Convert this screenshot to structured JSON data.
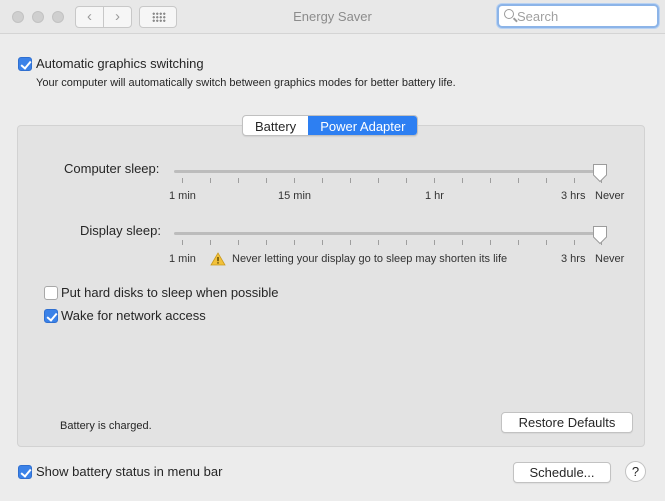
{
  "window": {
    "title": "Energy Saver",
    "search_placeholder": "Search"
  },
  "auto_graphics": {
    "label": "Automatic graphics switching",
    "description": "Your computer will automatically switch between graphics modes for better battery life.",
    "checked": true
  },
  "tabs": [
    {
      "label": "Battery",
      "active": false
    },
    {
      "label": "Power Adapter",
      "active": true
    }
  ],
  "computer_sleep": {
    "label": "Computer sleep:",
    "value": "Never",
    "ticks": [
      "1 min",
      "15 min",
      "1 hr",
      "3 hrs",
      "Never"
    ]
  },
  "display_sleep": {
    "label": "Display sleep:",
    "value": "Never",
    "ticks": [
      "1 min",
      "3 hrs",
      "Never"
    ],
    "warning": "Never letting your display go to sleep may shorten its life"
  },
  "options": {
    "hard_disks": {
      "label": "Put hard disks to sleep when possible",
      "checked": false
    },
    "wake_network": {
      "label": "Wake for network access",
      "checked": true
    }
  },
  "battery_status": "Battery is charged.",
  "restore_defaults": "Restore Defaults",
  "show_battery": {
    "label": "Show battery status in menu bar",
    "checked": true
  },
  "schedule": "Schedule...",
  "help": "?"
}
